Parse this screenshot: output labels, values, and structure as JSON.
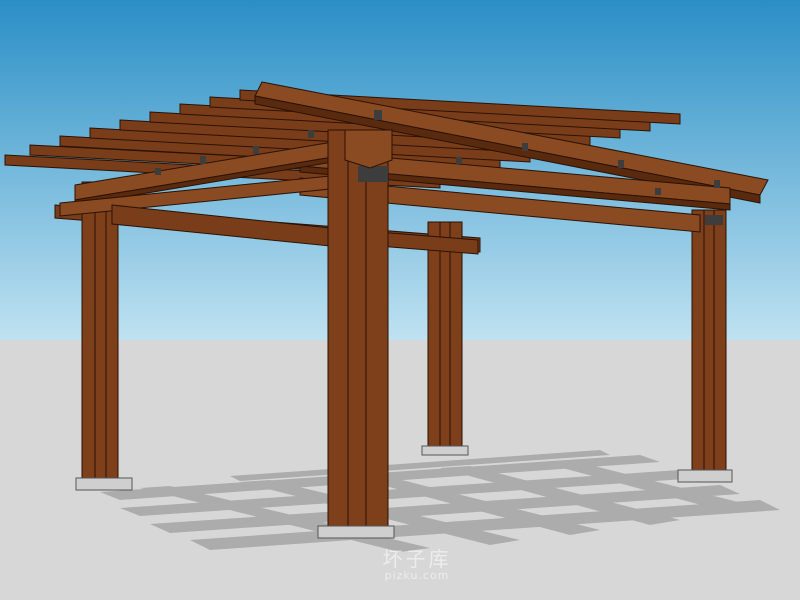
{
  "scene": {
    "subject": "pergola-3d-model",
    "colors": {
      "sky_top": "#2a8fc6",
      "sky_bottom": "#bfe2f1",
      "ground": "#d7d7d7",
      "wood_light": "#8a4a22",
      "wood_mid": "#7a3d1a",
      "wood_dark": "#4e240c",
      "wood_edge": "#2b1205",
      "bracket": "#3d3d3d",
      "base_plate": "#cfcfcf",
      "shadow": "#a9a9a9"
    }
  },
  "watermark": {
    "main": "坏子库",
    "sub": "pizku.com"
  }
}
